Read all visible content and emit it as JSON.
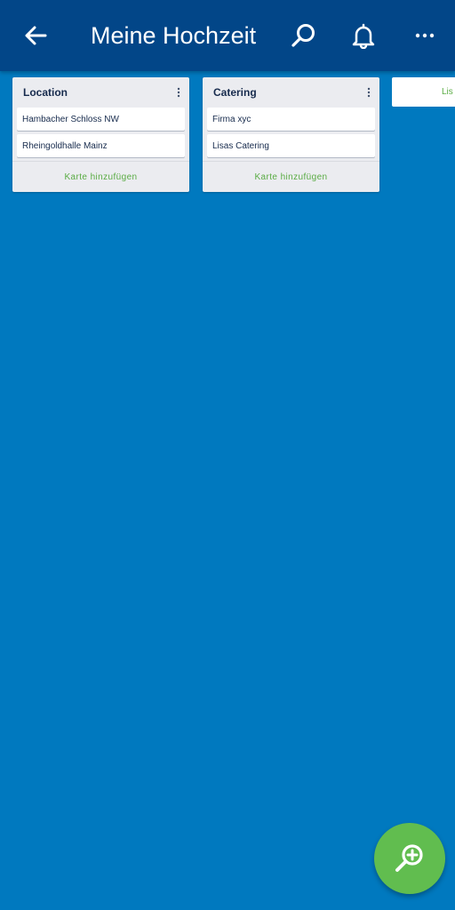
{
  "appbar": {
    "back_icon": "arrow-left-icon",
    "title": "Meine Hochzeit",
    "search_icon": "search-icon",
    "notifications_icon": "bell-icon",
    "more_icon": "more-horizontal-icon"
  },
  "lists": [
    {
      "title": "Location",
      "menu_icon": "more-vertical-icon",
      "cards": [
        "Hambacher Schloss NW",
        "Rheingoldhalle Mainz"
      ],
      "add_card_label": "Karte hinzufügen"
    },
    {
      "title": "Catering",
      "menu_icon": "more-vertical-icon",
      "cards": [
        "Firma xyc",
        "Lisas Catering"
      ],
      "add_card_label": "Karte hinzufügen"
    }
  ],
  "add_list": {
    "label": "Lis"
  },
  "fab": {
    "icon": "zoom-in-icon"
  },
  "colors": {
    "board_background": "#0079bf",
    "appbar": "#024688",
    "list_background": "#ebecf0",
    "accent_green": "#5aac44",
    "fab": "#61bd4f"
  }
}
